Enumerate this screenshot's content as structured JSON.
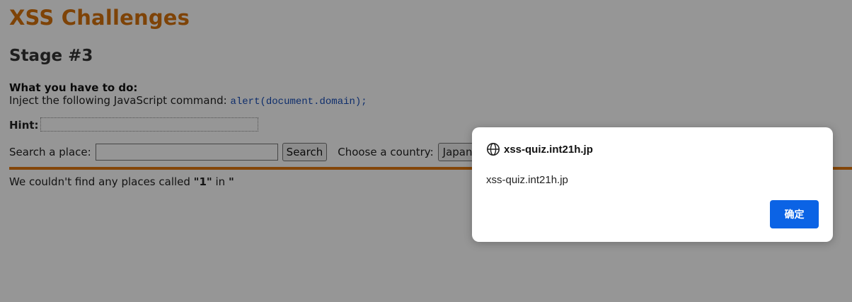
{
  "site": {
    "title": "XSS Challenges"
  },
  "stage": {
    "title": "Stage #3"
  },
  "task": {
    "heading": "What you have to do:",
    "instruction": "Inject the following JavaScript command: ",
    "command": "alert(document.domain);"
  },
  "hint": {
    "label": "Hint:",
    "value": ""
  },
  "search": {
    "label": "Search a place:",
    "value": "",
    "button_label": "Search",
    "country_label": "Choose a country:",
    "country_selected": "Japan"
  },
  "result": {
    "prefix": "We couldn't find any places called ",
    "query": "\"1\"",
    "middle": " in ",
    "country": "\""
  },
  "dialog": {
    "origin": "xss-quiz.int21h.jp",
    "message": "xss-quiz.int21h.jp",
    "ok_label": "确定",
    "icon": "globe-icon"
  },
  "colors": {
    "title": "#d6730c",
    "divider": "#e07810",
    "ok_button": "#0b63e5",
    "overlay": "rgba(0,0,0,0.41)"
  }
}
